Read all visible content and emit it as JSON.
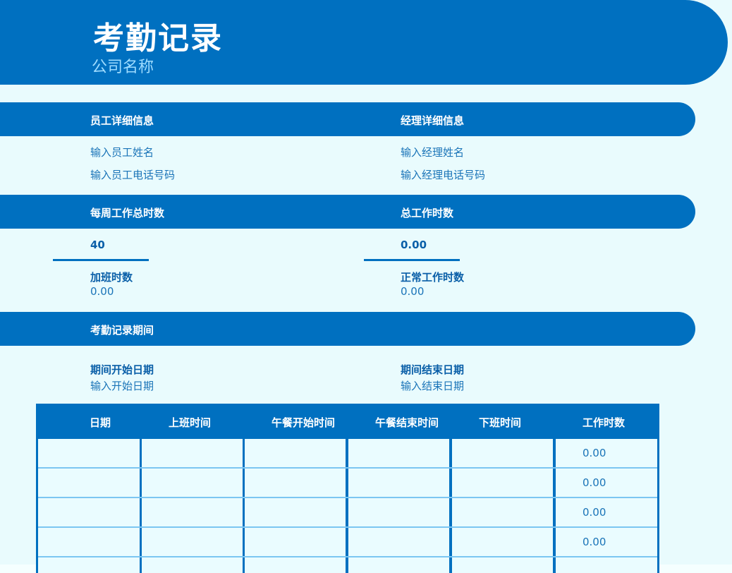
{
  "header": {
    "title": "考勤记录",
    "company": "公司名称"
  },
  "employee_section": {
    "title": "员工详细信息",
    "name_placeholder": "输入员工姓名",
    "phone_placeholder": "输入员工电话号码"
  },
  "manager_section": {
    "title": "经理详细信息",
    "name_placeholder": "输入经理姓名",
    "phone_placeholder": "输入经理电话号码"
  },
  "hours_section": {
    "weekly_label": "每周工作总时数",
    "total_label": "总工作时数",
    "weekly_value": "40",
    "total_value": "0.00",
    "overtime_label": "加班时数",
    "overtime_value": "0.00",
    "regular_label": "正常工作时数",
    "regular_value": "0.00"
  },
  "period_section": {
    "title": "考勤记录期间",
    "start_label": "期间开始日期",
    "start_placeholder": "输入开始日期",
    "end_label": "期间结束日期",
    "end_placeholder": "输入结束日期"
  },
  "table": {
    "columns": [
      "日期",
      "上班时间",
      "午餐开始时间",
      "午餐结束时间",
      "下班时间",
      "工作时数"
    ],
    "rows": [
      {
        "date": "",
        "in": "",
        "lunch_start": "",
        "lunch_end": "",
        "out": "",
        "hours": "0.00"
      },
      {
        "date": "",
        "in": "",
        "lunch_start": "",
        "lunch_end": "",
        "out": "",
        "hours": "0.00"
      },
      {
        "date": "",
        "in": "",
        "lunch_start": "",
        "lunch_end": "",
        "out": "",
        "hours": "0.00"
      },
      {
        "date": "",
        "in": "",
        "lunch_start": "",
        "lunch_end": "",
        "out": "",
        "hours": "0.00"
      }
    ]
  },
  "colors": {
    "primary": "#0070c0",
    "background": "#e9fbfd",
    "subtitle": "#9fdcff"
  }
}
